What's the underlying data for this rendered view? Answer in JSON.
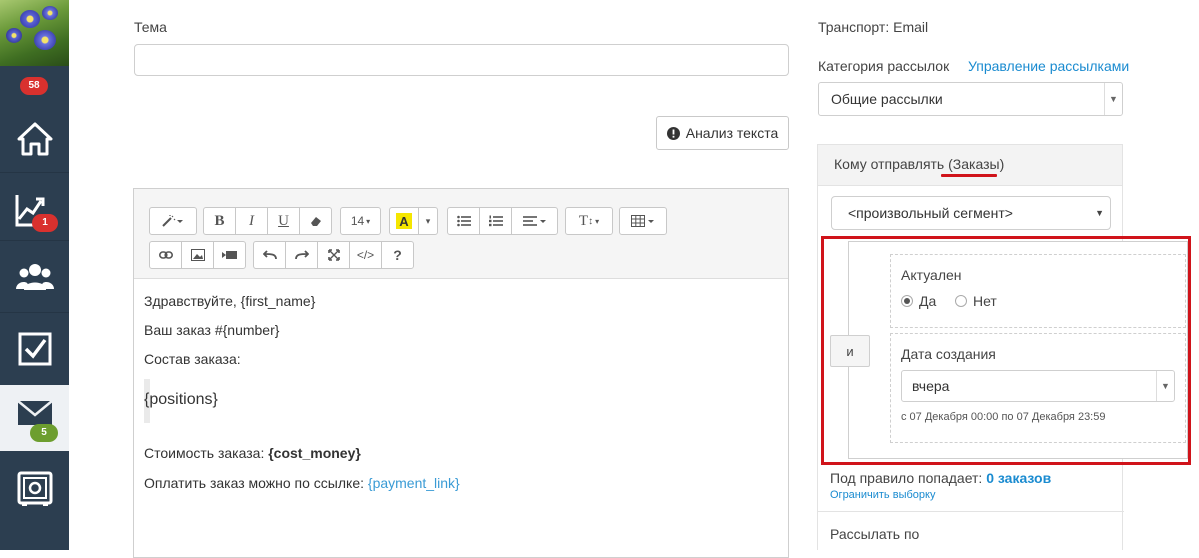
{
  "sidebar": {
    "avatar_badge": "58",
    "items": [
      {
        "icon": "home-icon",
        "badge": ""
      },
      {
        "icon": "analytics-icon",
        "badge": "1"
      },
      {
        "icon": "users-icon",
        "badge": ""
      },
      {
        "icon": "tasks-icon",
        "badge": ""
      },
      {
        "icon": "mail-icon",
        "badge": "5"
      },
      {
        "icon": "safe-icon",
        "badge": ""
      }
    ]
  },
  "subject": {
    "label": "Тема",
    "value": ""
  },
  "analyze_button": {
    "label": "Анализ текста",
    "icon": "exclamation-circle-icon"
  },
  "editor": {
    "toolbar": {
      "font_size": "14",
      "highlight_color": "#f5e600"
    },
    "content": {
      "line1": "Здравствуйте, {first_name}",
      "line2": "Ваш заказ #{number}",
      "line3": "Состав заказа:",
      "quote": "{positions}",
      "cost_prefix": "Стоимость заказа: ",
      "cost_placeholder": "{cost_money}",
      "pay_prefix": "Оплатить заказ можно по ссылке: ",
      "pay_placeholder": "{payment_link}"
    }
  },
  "right": {
    "transport": "Транспорт: Email",
    "category_label": "Категория рассылок",
    "manage_link": "Управление рассылками",
    "category_value": "Общие рассылки",
    "send_to_prefix": "Кому отправлять ",
    "send_to_entity": "(Заказы)",
    "segment_value": "<произвольный сегмент>",
    "and_label": "и",
    "rule1": {
      "title": "Актуален",
      "option_yes": "Да",
      "option_no": "Нет",
      "selected": "Да"
    },
    "rule2": {
      "title": "Дата создания",
      "value": "вчера",
      "range": "с 07 Декабря 00:00 по 07 Декабря 23:59"
    },
    "matches_prefix": "Под правило попадает: ",
    "matches_value": "0 заказов",
    "limit_link": "Ограничить выборку",
    "send_by_label": "Рассылать по"
  },
  "colors": {
    "sidebar": "#2c3e50",
    "accent_link": "#1a8bd0",
    "highlight": "#d0131a",
    "badge_red": "#d9312e",
    "badge_green": "#6d9e2f"
  }
}
